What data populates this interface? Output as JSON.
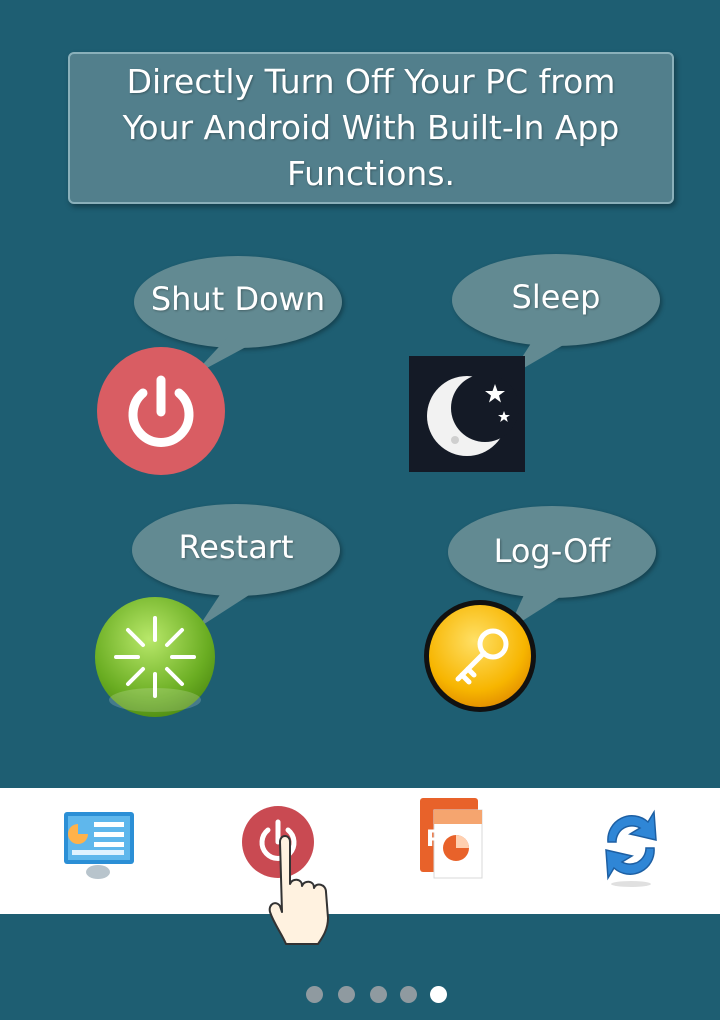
{
  "title": "Directly Turn Off Your PC from Your Android With Built-In App Functions.",
  "actions": {
    "shutdown": {
      "label": "Shut Down",
      "icon": "power-icon"
    },
    "sleep": {
      "label": "Sleep",
      "icon": "moon-stars-icon"
    },
    "restart": {
      "label": "Restart",
      "icon": "restart-burst-icon"
    },
    "logoff": {
      "label": "Log-Off",
      "icon": "key-icon"
    }
  },
  "bottom_nav": [
    {
      "icon": "remote-desktop-icon"
    },
    {
      "icon": "power-icon",
      "selected": true
    },
    {
      "icon": "powerpoint-icon"
    },
    {
      "icon": "refresh-icon"
    }
  ],
  "pager": {
    "count": 5,
    "active_index": 4
  },
  "colors": {
    "background": "#1e5e72",
    "bubble": "#628a92",
    "shutdown": "#d95d63",
    "sleep_bg": "#141a26",
    "restart": "#7fbf2e",
    "logoff": "#f5b400"
  }
}
